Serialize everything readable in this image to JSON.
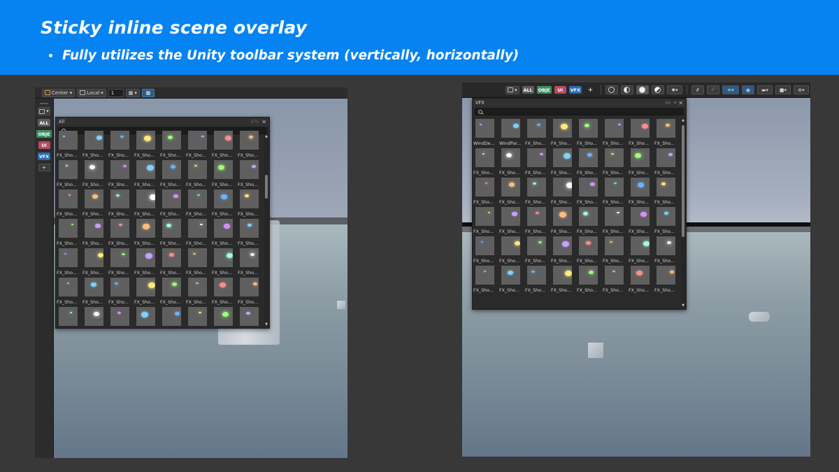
{
  "slide": {
    "title": "Sticky inline scene overlay",
    "bullet": "Fully utilizes the Unity toolbar system (vertically, horizontally)"
  },
  "left_scene": {
    "topbar": {
      "pivot_label": "Center",
      "space_label": "Local",
      "grid_value": "1"
    },
    "tags": [
      "ALL",
      "OBJE",
      "UI",
      "VFX",
      "+"
    ],
    "panel": {
      "title": "All",
      "count": "475",
      "close": "✕",
      "labels": [
        "FX_Sho...",
        "FX_Sho...",
        "FX_Sho...",
        "FX_Sho...",
        "FX_Sho...",
        "FX_Sho...",
        "FX_Sho...",
        "FX_Sho...",
        "FX_Sho...",
        "FX_Sho...",
        "FX_Sho...",
        "FX_Sho...",
        "FX_Sho...",
        "FX_Sho...",
        "FX_Sho...",
        "FX_Sho...",
        "FX_Sho...",
        "FX_Sho...",
        "FX_Sho...",
        "FX_Sho...",
        "FX_Sho...",
        "FX_Sho...",
        "FX_Sho...",
        "FX_Sho...",
        "FX_Sho...",
        "FX_Sho...",
        "FX_Sho...",
        "FX_Sho...",
        "FX_Sho...",
        "FX_Sho...",
        "FX_Sho...",
        "FX_Sho...",
        "FX_Sho...",
        "FX_Sho...",
        "FX_Sho...",
        "FX_Sho...",
        "FX_Sho...",
        "FX_Sho...",
        "FX_Sho...",
        "FX_Sho...",
        "FX_Sho...",
        "FX_Sho...",
        "FX_Sho...",
        "FX_Sho...",
        "FX_Sho...",
        "FX_Sho...",
        "FX_Sho...",
        "FX_Sho...",
        "FX_Sho...",
        "FX_Sho...",
        "FX_Sho...",
        "FX_Sho...",
        "FX_Sho...",
        "FX_Sho...",
        "FX_Sho...",
        "FX_Sho..."
      ]
    }
  },
  "right_scene": {
    "tags": [
      "ALL",
      "OBJE",
      "UI",
      "VFX",
      "+"
    ],
    "panel": {
      "title": "VFX",
      "count": "88",
      "close": "✕",
      "labels": [
        "WindDe...",
        "WindPar...",
        "FX_Sho...",
        "FX_Sho...",
        "FX_Sho...",
        "FX_Sho...",
        "FX_Sho...",
        "FX_Sho...",
        "FX_Sho...",
        "FX_Sho...",
        "FX_Sho...",
        "FX_Sho...",
        "FX_Sho...",
        "FX_Sho...",
        "FX_Sho...",
        "FX_Sho...",
        "FX_Sho...",
        "FX_Sho...",
        "FX_Sho...",
        "FX_Sho...",
        "FX_Sho...",
        "FX_Sho...",
        "FX_Sho...",
        "FX_Sho...",
        "FX_Sho...",
        "FX_Sho...",
        "FX_Sho...",
        "FX_Sho...",
        "FX_Sho...",
        "FX_Sho...",
        "FX_Sho...",
        "FX_Sho...",
        "FX_Sho...",
        "FX_Sho...",
        "FX_Sho...",
        "FX_Sho...",
        "FX_Sho...",
        "FX_Sho...",
        "FX_Sho...",
        "FX_Sho...",
        "FX_Sho...",
        "FX_Sho...",
        "FX_Sho...",
        "FX_Sho...",
        "FX_Sho...",
        "FX_Sho...",
        "FX_Sho...",
        "FX_Sho..."
      ]
    }
  },
  "colors": {
    "banner": "#0583f2",
    "tag_obje": "#3e8e63",
    "tag_ui": "#b44b63",
    "tag_vfx": "#2c69b3"
  }
}
